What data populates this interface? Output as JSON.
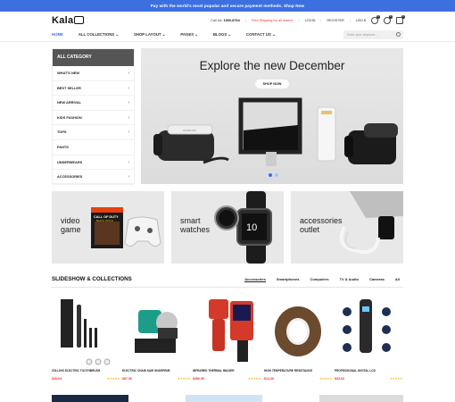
{
  "topbar": {
    "text": "Pay with the world's most popular and secure payment methods. Shop Now"
  },
  "header": {
    "logo": "Kala",
    "phone_label": "Call Us:",
    "phone": "1900-8764",
    "free_shipping": "Free Shipping for all orders!",
    "login": "LOGIN",
    "register": "REGISTER",
    "currency": "USD $",
    "badges": {
      "compare": "0",
      "wishlist": "0",
      "cart": "0"
    }
  },
  "nav": {
    "items": [
      "HOME",
      "ALL COLLECTIONS",
      "SHOP LAYOUT",
      "PAGES",
      "BLOGS",
      "CONTACT US"
    ],
    "search_placeholder": "Enter your keyword..."
  },
  "sidebar": {
    "title": "ALL CATEGORY",
    "items": [
      "WHAT'S NEW",
      "BEST SELLER",
      "NEW ARRIVAL",
      "KIDS FASHION",
      "TOPS",
      "PANTS",
      "UNDERWEARS",
      "ACCESSORIES"
    ]
  },
  "hero": {
    "title": "Explore the new December",
    "button": "SHOP NOW",
    "vr_brand": "SAMSUNG"
  },
  "promos": [
    {
      "label1": "video",
      "label2": "game",
      "game_title": "CALL OF DUTY",
      "game_sub": "BLACK OPS III"
    },
    {
      "label1": "smart",
      "label2": "watches",
      "watch_time": "10"
    },
    {
      "label1": "accessories",
      "label2": "outlet"
    }
  ],
  "collections": {
    "title": "SLIDESHOW & COLLECTIONS",
    "tabs": [
      "Accessories",
      "Smartphones",
      "Computers",
      "TV & Audio",
      "Cameras",
      "All"
    ]
  },
  "products": [
    {
      "name": "ZOLLIHO ELECTRIC TOOTHBRUSH",
      "price": "$40.64",
      "stars": "★★★★★"
    },
    {
      "name": "ELECTRIC CHAIN SAW SHARPENE",
      "price": "$87.56",
      "stars": "★★★★★"
    },
    {
      "name": "INFRARED THERMAL IMAGER",
      "price": "$480.56",
      "stars": "★★★★★"
    },
    {
      "name": "HIGH TEMPERATURE RESISTANCE",
      "price": "$14.66",
      "stars": "★★★★★"
    },
    {
      "name": "PROFESSIONAL DIGITAL LCD",
      "price": "$33.63",
      "stars": "★★★★★"
    }
  ],
  "colors": {
    "accent": "#3c6fe0",
    "price": "#ee3333",
    "star": "#f2b01e"
  }
}
